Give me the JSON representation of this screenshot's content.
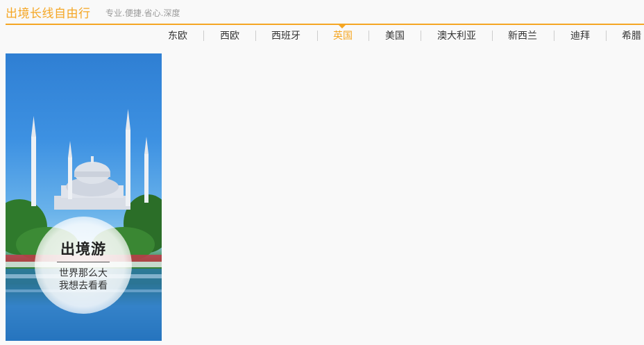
{
  "header": {
    "title": "出境长线自由行",
    "subtitle": "专业.便捷.省心.深度"
  },
  "nav": {
    "items": [
      "东欧",
      "西欧",
      "西班牙",
      "英国",
      "美国",
      "澳大利亚",
      "新西兰",
      "迪拜",
      "希腊"
    ],
    "active": "英国"
  },
  "banner": {
    "title": "出境游",
    "line1": "世界那么大",
    "line2": "我想去看看"
  },
  "colors": {
    "accent": "#f5a623",
    "nav_text": "#333333",
    "subtitle": "#999999"
  }
}
